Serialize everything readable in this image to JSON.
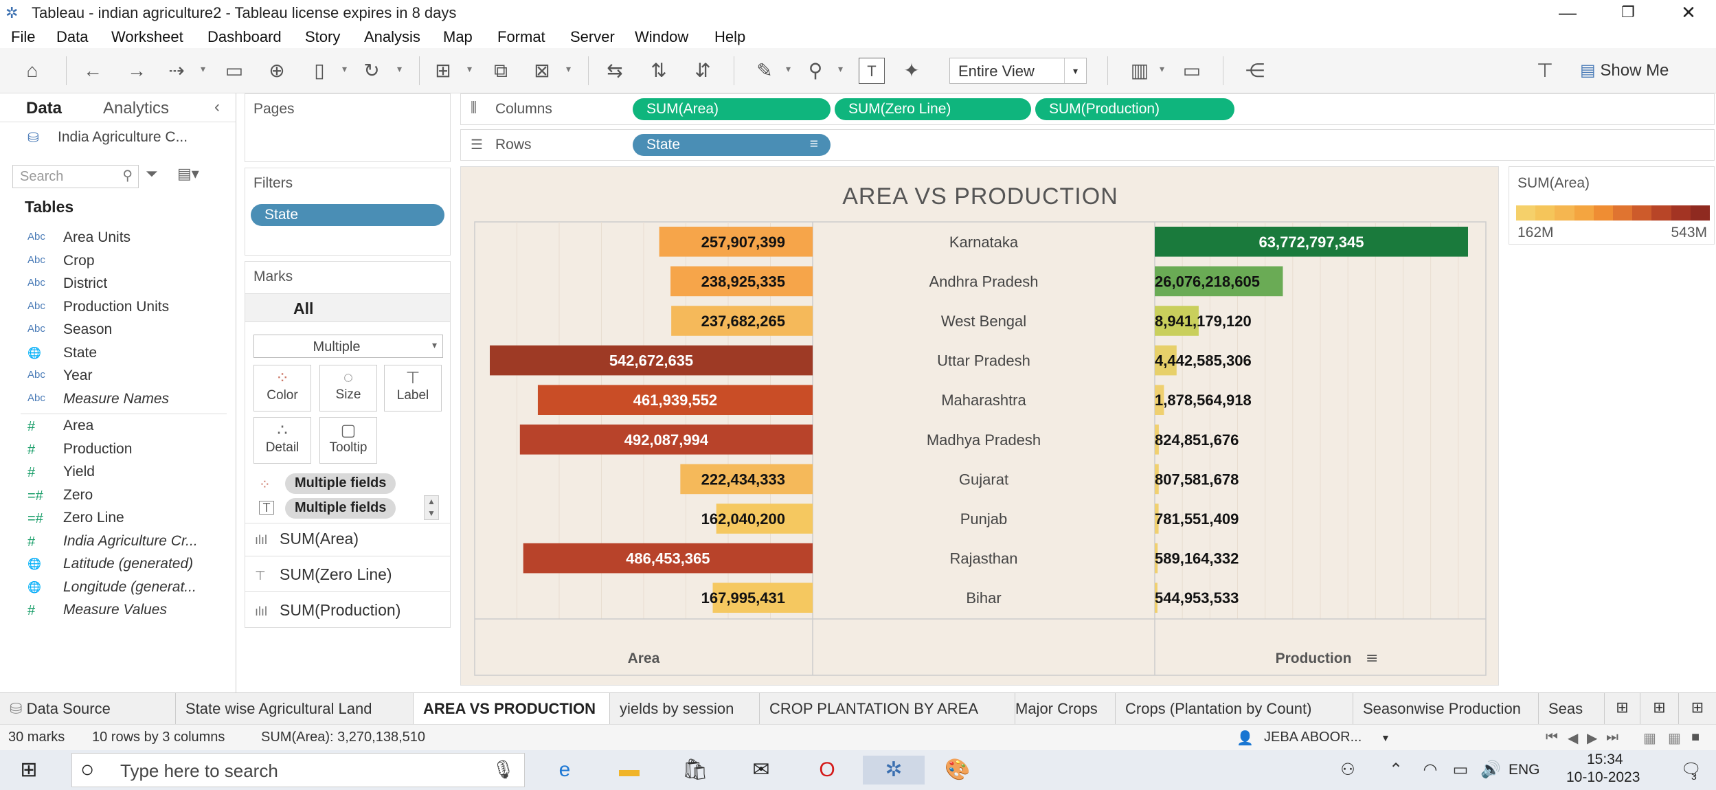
{
  "window": {
    "title": "Tableau - indian agriculture2 - Tableau license expires in 8 days"
  },
  "menu": [
    "File",
    "Data",
    "Worksheet",
    "Dashboard",
    "Story",
    "Analysis",
    "Map",
    "Format",
    "Server",
    "Window",
    "Help"
  ],
  "toolbar": {
    "fit": "Entire View",
    "show_me": "Show Me"
  },
  "data_pane": {
    "tab_data": "Data",
    "tab_analytics": "Analytics",
    "datasource": "India Agriculture C...",
    "search_placeholder": "Search",
    "tables_label": "Tables",
    "dimensions": [
      {
        "type": "Abc",
        "name": "Area Units",
        "italic": false
      },
      {
        "type": "Abc",
        "name": "Crop",
        "italic": false
      },
      {
        "type": "Abc",
        "name": "District",
        "italic": false
      },
      {
        "type": "Abc",
        "name": "Production Units",
        "italic": false
      },
      {
        "type": "Abc",
        "name": "Season",
        "italic": false
      },
      {
        "type": "globe",
        "name": "State",
        "italic": false
      },
      {
        "type": "Abc",
        "name": "Year",
        "italic": false
      },
      {
        "type": "Abc",
        "name": "Measure Names",
        "italic": true
      }
    ],
    "measures": [
      {
        "type": "#",
        "name": "Area",
        "italic": false
      },
      {
        "type": "#",
        "name": "Production",
        "italic": false
      },
      {
        "type": "#",
        "name": "Yield",
        "italic": false
      },
      {
        "type": "=#",
        "name": "Zero",
        "italic": false
      },
      {
        "type": "=#",
        "name": "Zero Line",
        "italic": false
      },
      {
        "type": "#",
        "name": "India Agriculture Cr...",
        "italic": true
      },
      {
        "type": "globe",
        "name": "Latitude (generated)",
        "italic": true
      },
      {
        "type": "globe",
        "name": "Longitude (generat...",
        "italic": true
      },
      {
        "type": "#",
        "name": "Measure Values",
        "italic": true
      }
    ]
  },
  "pages": {
    "label": "Pages"
  },
  "filters": {
    "label": "Filters",
    "items": [
      "State"
    ]
  },
  "marks": {
    "label": "Marks",
    "all": "All",
    "type": "Multiple",
    "buttons": [
      "Color",
      "Size",
      "Label",
      "Detail",
      "Tooltip"
    ],
    "color_pill": "Multiple fields",
    "label_pill": "Multiple fields",
    "cards": [
      "SUM(Area)",
      "SUM(Zero Line)",
      "SUM(Production)"
    ]
  },
  "shelves": {
    "columns_label": "Columns",
    "columns": [
      "SUM(Area)",
      "SUM(Zero Line)",
      "SUM(Production)"
    ],
    "rows_label": "Rows",
    "rows": [
      "State"
    ]
  },
  "legend": {
    "title": "SUM(Area)",
    "min": "162M",
    "max": "543M"
  },
  "chart_data": {
    "type": "bar",
    "title": "AREA VS PRODUCTION",
    "categories": [
      "Karnataka",
      "Andhra Pradesh",
      "West Bengal",
      "Uttar Pradesh",
      "Maharashtra",
      "Madhya Pradesh",
      "Gujarat",
      "Punjab",
      "Rajasthan",
      "Bihar"
    ],
    "series": [
      {
        "name": "Area",
        "values": [
          257907399,
          238925335,
          237682265,
          542672635,
          461939552,
          492087994,
          222434333,
          162040200,
          486453365,
          167995431
        ],
        "labels": [
          "257,907,399",
          "238,925,335",
          "237,682,265",
          "542,672,635",
          "461,939,552",
          "492,087,994",
          "222,434,333",
          "162,040,200",
          "486,453,365",
          "167,995,431"
        ],
        "colors": [
          "#f6a54a",
          "#f6a54a",
          "#f5b95a",
          "#9e3a25",
          "#c94d26",
          "#b8432a",
          "#f5b95a",
          "#f5c860",
          "#b8432a",
          "#f5c860"
        ]
      },
      {
        "name": "Production",
        "values": [
          63772797345,
          26076218605,
          8941179120,
          4442585306,
          1878564918,
          824851676,
          807581678,
          781551409,
          589164332,
          544953533
        ],
        "labels": [
          "63,772,797,345",
          "26,076,218,605",
          "8,941,179,120",
          "4,442,585,306",
          "1,878,564,918",
          "824,851,676",
          "807,581,678",
          "781,551,409",
          "589,164,332",
          "544,953,533"
        ],
        "colors": [
          "#1a7a3c",
          "#6aab55",
          "#c9cf5c",
          "#e7d06a",
          "#efd070",
          "#f0d070",
          "#f0d070",
          "#f0d070",
          "#f0d070",
          "#f0d070"
        ]
      }
    ],
    "xlabels": [
      "Area",
      "Production"
    ]
  },
  "sheet_tabs": [
    "Data Source",
    "State wise Agricultural Land",
    "AREA VS PRODUCTION",
    "yields by session",
    "CROP PLANTATION BY AREA",
    "Major Crops",
    "Crops (Plantation by Count)",
    "Seasonwise Production",
    "Seas"
  ],
  "active_tab": "AREA VS PRODUCTION",
  "status": {
    "marks": "30 marks",
    "rows_cols": "10 rows by 3 columns",
    "sum": "SUM(Area): 3,270,138,510",
    "user": "JEBA ABOOR..."
  },
  "taskbar": {
    "search_placeholder": "Type here to search",
    "lang": "ENG",
    "time": "15:34",
    "date": "10-10-2023",
    "notif": "3"
  }
}
